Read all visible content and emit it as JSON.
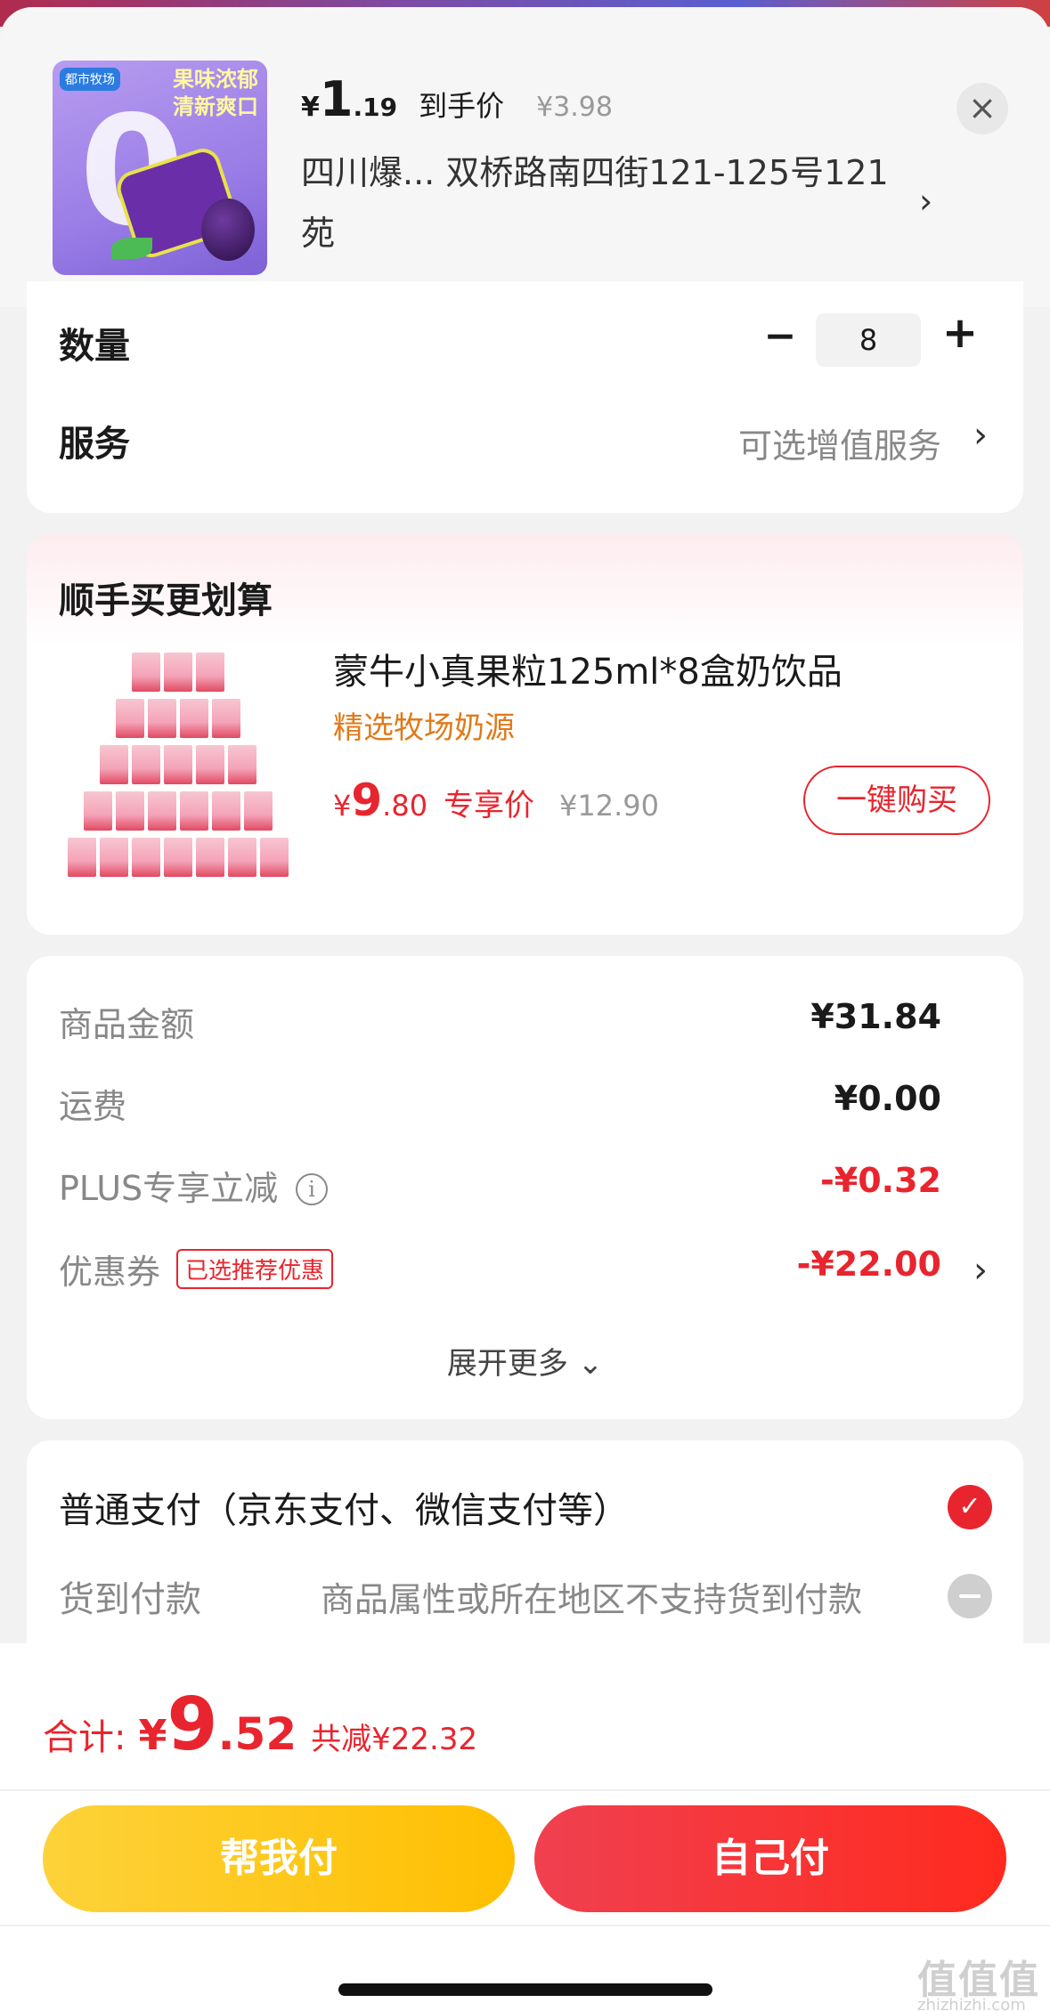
{
  "header": {
    "price": {
      "currency": "¥",
      "integer": "1",
      "decimal": ".19",
      "label": "到手价",
      "original": "¥3.98"
    },
    "address": "四川爆...  双桥路南四街121-125号121苑",
    "address_arrow": "›",
    "close_icon": "×",
    "thumb": {
      "brand": "都市牧场",
      "slogan_line1": "果味浓郁",
      "slogan_line2": "清新爽口"
    }
  },
  "quantity": {
    "label": "数量",
    "minus": "−",
    "value": "8",
    "plus": "+"
  },
  "service": {
    "label": "服务",
    "value": "可选增值服务",
    "arrow": "›"
  },
  "upsell": {
    "title": "顺手买更划算",
    "product_name": "蒙牛小真果粒125ml*8盒奶饮品",
    "tag": "精选牧场奶源",
    "price_currency": "¥",
    "price_integer": "9",
    "price_decimal": ".80",
    "price_label": "专享价",
    "original_price": "¥12.90",
    "buy_button": "一键购买"
  },
  "summary": {
    "goods_amount_label": "商品金额",
    "goods_amount": "¥31.84",
    "shipping_label": "运费",
    "shipping": "¥0.00",
    "plus_label": "PLUS专享立减",
    "plus_discount": "-¥0.32",
    "coupon_label": "优惠券",
    "coupon_tag": "已选推荐优惠",
    "coupon_discount": "-¥22.00",
    "coupon_arrow": "›",
    "expand": "展开更多 ⌄"
  },
  "payment": {
    "option1": "普通支付（京东支付、微信支付等）",
    "option2_label": "货到付款",
    "option2_note": "商品属性或所在地区不支持货到付款"
  },
  "footer": {
    "total_label": "合计:",
    "total_currency": "¥",
    "total_integer": "9",
    "total_decimal": ".52",
    "total_saving": "共减¥22.32",
    "help_pay": "帮我付",
    "self_pay": "自己付",
    "watermark": "值值值",
    "watermark_url": "zhizhizhi.com"
  },
  "colors": {
    "accent": "#e8252e",
    "yellow": "#ffbf00",
    "coupon_tag": "#e8252e"
  }
}
